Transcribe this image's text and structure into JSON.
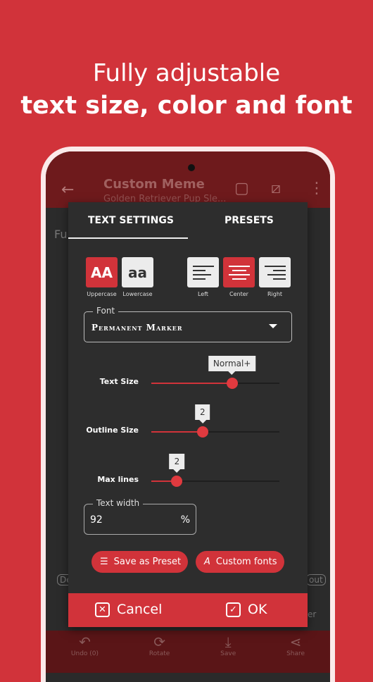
{
  "headline": {
    "line1": "Fully adjustable",
    "line2": "text size, color and font"
  },
  "appbar": {
    "title": "Custom Meme",
    "subtitle": "Golden Retriever Pup Sle..."
  },
  "background_fragments": {
    "input": "Fu",
    "chip_left": "De",
    "chip_right": "out",
    "button": "er"
  },
  "bottom_bar": [
    {
      "icon": "undo-icon",
      "label": "Undo (0)"
    },
    {
      "icon": "rotate-icon",
      "label": "Rotate"
    },
    {
      "icon": "save-icon",
      "label": "Save"
    },
    {
      "icon": "share-icon",
      "label": "Share"
    }
  ],
  "dialog": {
    "tabs": [
      {
        "label": "TEXT SETTINGS",
        "active": true
      },
      {
        "label": "PRESETS",
        "active": false
      }
    ],
    "case": [
      {
        "glyph": "AA",
        "label": "Uppercase",
        "selected": true
      },
      {
        "glyph": "aa",
        "label": "Lowercase",
        "selected": false
      }
    ],
    "align": [
      {
        "label": "Left",
        "selected": false
      },
      {
        "label": "Center",
        "selected": true
      },
      {
        "label": "Right",
        "selected": false
      }
    ],
    "font": {
      "label": "Font",
      "value": "Permanent Marker"
    },
    "sliders": [
      {
        "label": "Text Size",
        "value_text": "Normal+",
        "fraction": 0.63
      },
      {
        "label": "Outline Size",
        "value_text": "2",
        "fraction": 0.4
      },
      {
        "label": "Max lines",
        "value_text": "2",
        "fraction": 0.2
      }
    ],
    "text_width": {
      "label": "Text width",
      "value": "92",
      "unit": "%"
    },
    "save_preset": "Save as Preset",
    "custom_fonts": "Custom fonts",
    "cancel": "Cancel",
    "ok": "OK"
  },
  "colors": {
    "accent": "#d1333a",
    "dialog_bg": "#2d2d2d"
  }
}
